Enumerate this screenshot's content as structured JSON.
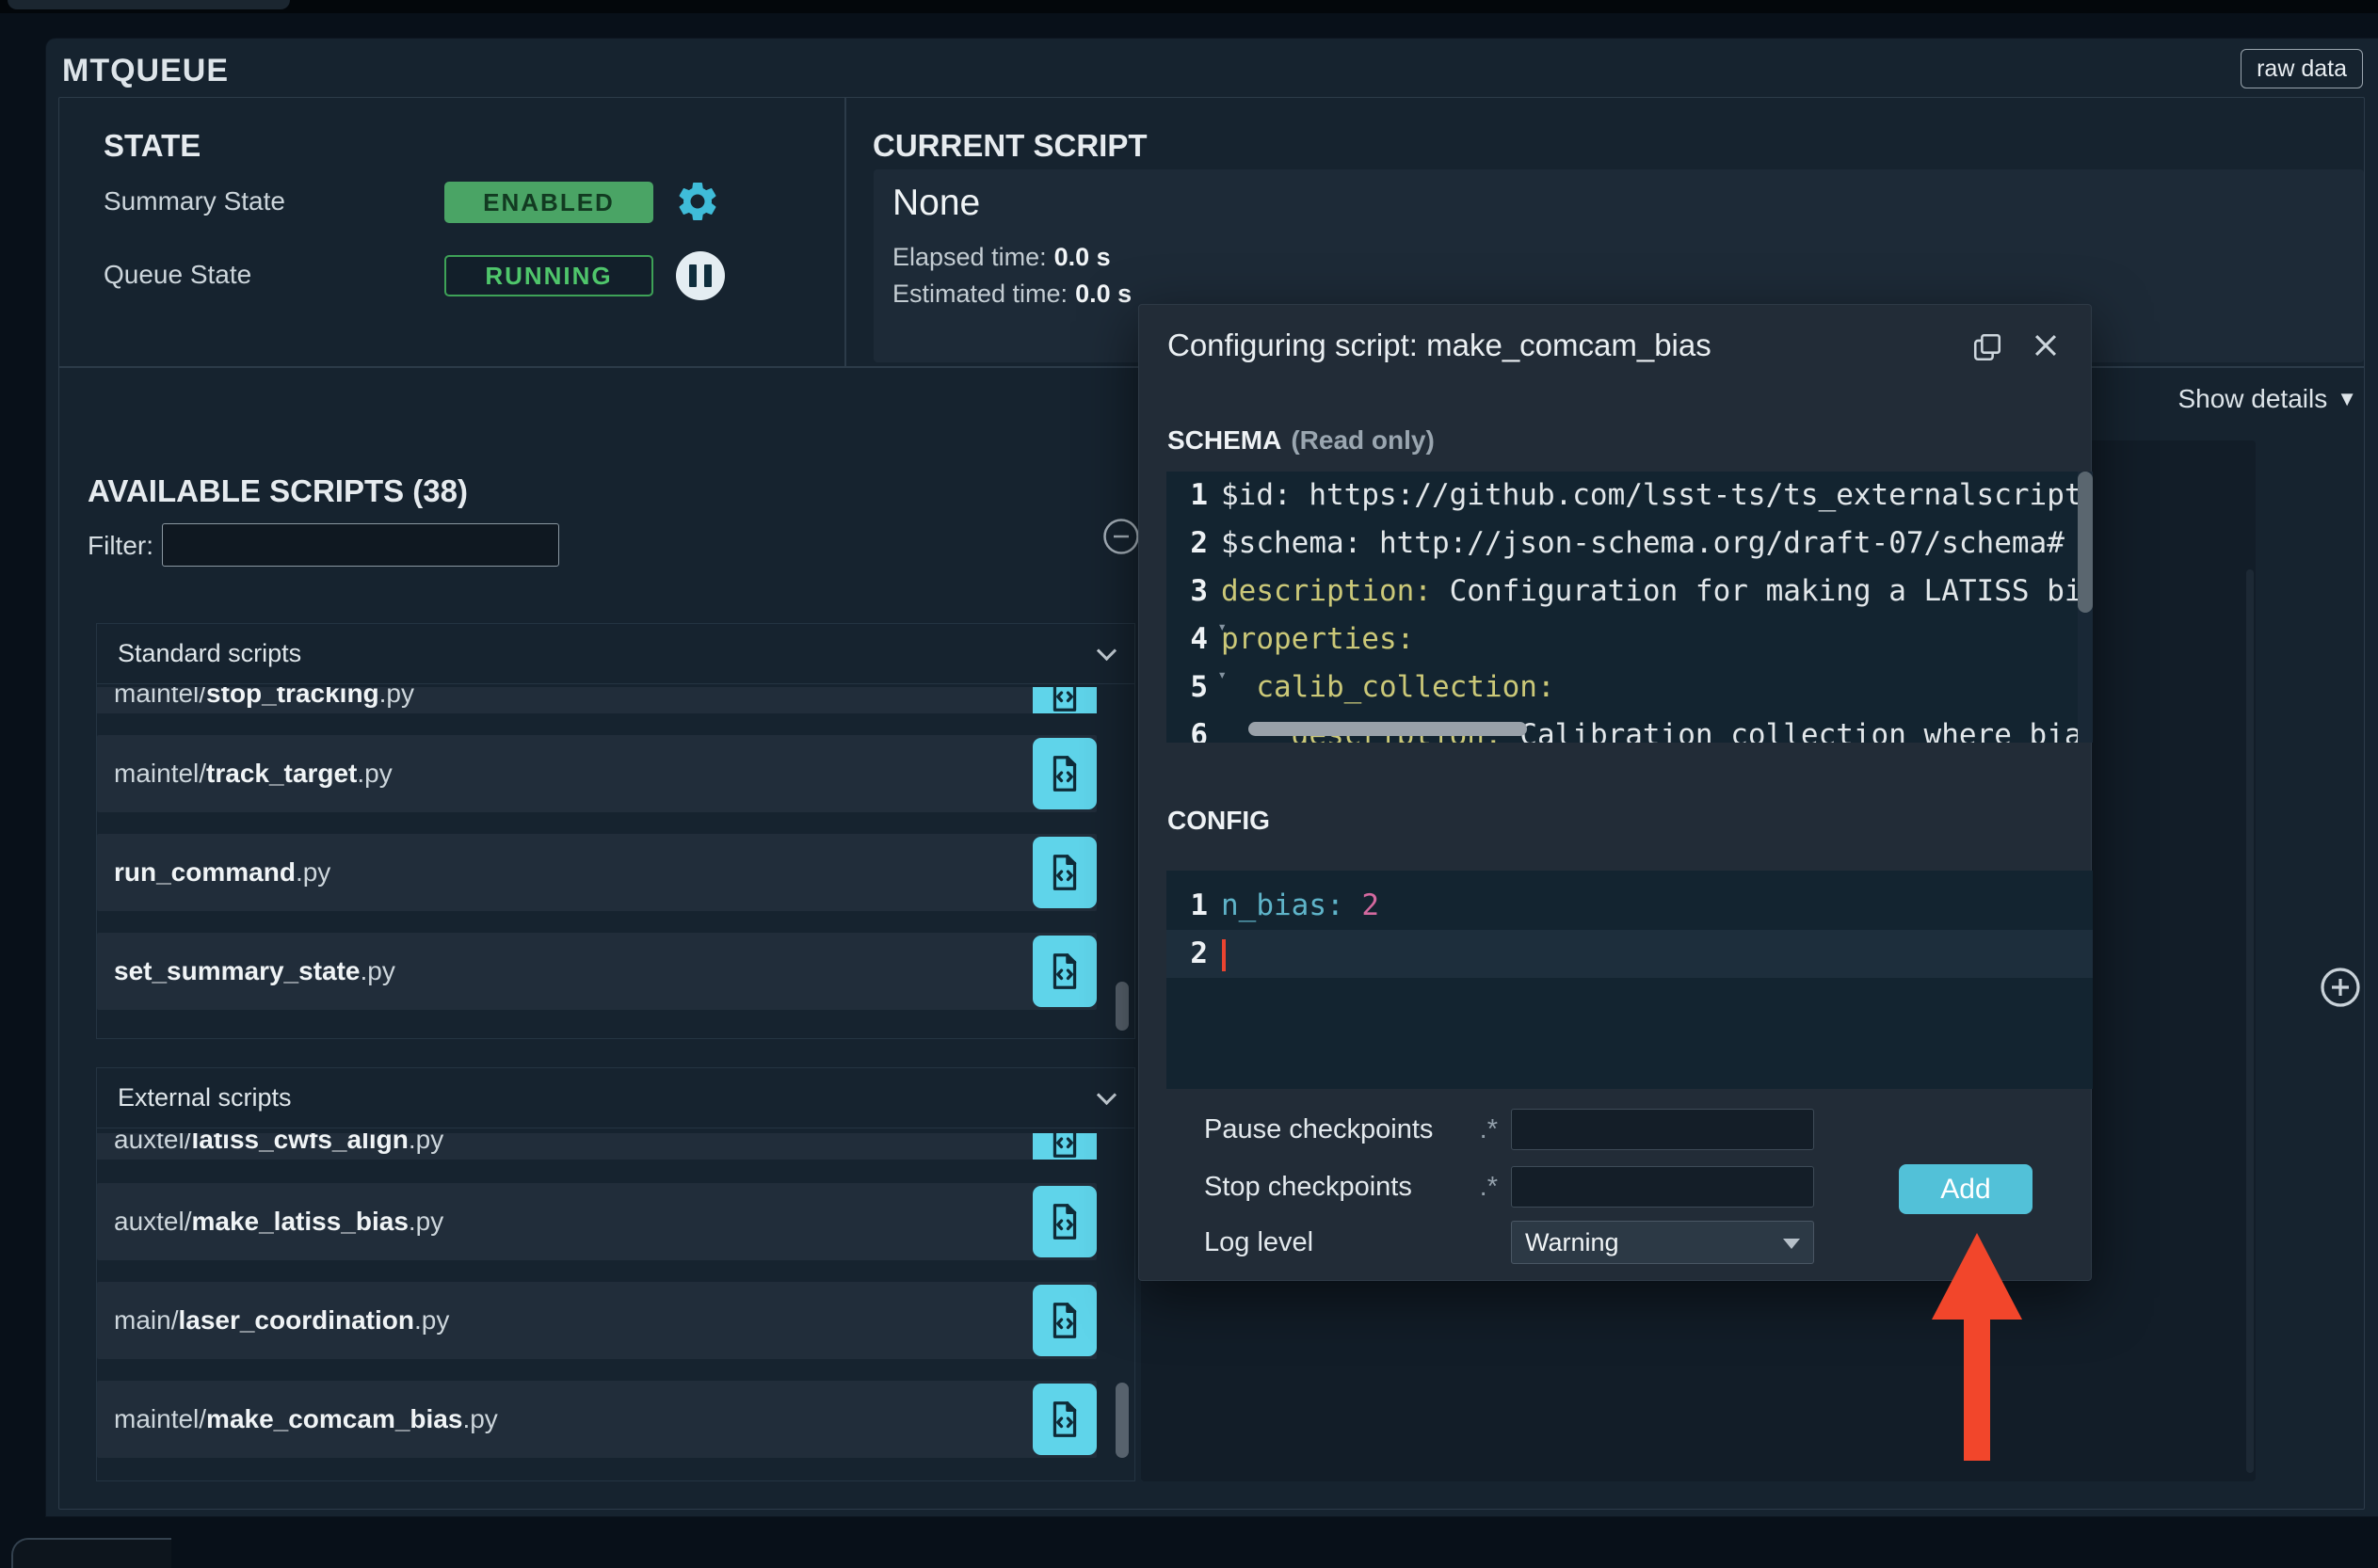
{
  "colors": {
    "accent_cyan": "#5fd4ea",
    "enabled_green": "#4aa465",
    "running_green": "#4fc66b",
    "add_button_cyan": "#52c1d8",
    "arrow_red": "#f2462b"
  },
  "icons": {
    "gear": "settings-gear",
    "pause": "pause-circle",
    "launch": "script-file",
    "collapse": "circle-minus",
    "copy": "duplicate",
    "close": "x",
    "chevron": "chevron-down",
    "plus": "plus-circle",
    "dropdown": "caret-down"
  },
  "page": {
    "title": "MTQUEUE",
    "raw_data_label": "raw data",
    "show_details_label": "Show details",
    "show_details_caret": "▼"
  },
  "state": {
    "heading": "STATE",
    "rows": [
      {
        "label": "Summary State",
        "value": "ENABLED"
      },
      {
        "label": "Queue State",
        "value": "RUNNING"
      }
    ]
  },
  "current_script": {
    "heading": "CURRENT SCRIPT",
    "name": "None",
    "elapsed": {
      "label": "Elapsed time:",
      "value": "0.0 s"
    },
    "estimated": {
      "label": "Estimated time:",
      "value": "0.0 s"
    }
  },
  "available": {
    "heading": "AVAILABLE SCRIPTS (38)",
    "filter_label": "Filter:",
    "filter_value": "",
    "sections": [
      {
        "label": "Standard scripts",
        "partial": {
          "path": "maintel/",
          "name": "stop_tracking",
          "ext": ".py"
        },
        "scripts": [
          {
            "path": "maintel/",
            "name": "track_target",
            "ext": ".py"
          },
          {
            "path": "",
            "name": "run_command",
            "ext": ".py"
          },
          {
            "path": "",
            "name": "set_summary_state",
            "ext": ".py"
          }
        ]
      },
      {
        "label": "External scripts",
        "partial": {
          "path": "auxtel/",
          "name": "latiss_cwfs_align",
          "ext": ".py"
        },
        "scripts": [
          {
            "path": "auxtel/",
            "name": "make_latiss_bias",
            "ext": ".py"
          },
          {
            "path": "main/",
            "name": "laser_coordination",
            "ext": ".py"
          },
          {
            "path": "maintel/",
            "name": "make_comcam_bias",
            "ext": ".py"
          }
        ]
      }
    ]
  },
  "modal": {
    "title": "Configuring script: make_comcam_bias",
    "schema": {
      "heading": "SCHEMA",
      "note": "(Read only)",
      "lines": [
        {
          "num": "1",
          "key": "$id:",
          "value": " https://github.com/lsst-ts/ts_externalscripts"
        },
        {
          "num": "2",
          "key": "$schema:",
          "value": " http://json-schema.org/draft-07/schema#"
        },
        {
          "num": "3",
          "key": "description:",
          "value": " Configuration for making a LATISS bias"
        },
        {
          "num": "4",
          "key": "properties:",
          "value": "",
          "fold": "▾"
        },
        {
          "num": "5",
          "key": "  calib_collection:",
          "value": "",
          "fold": "▾"
        },
        {
          "num": "6",
          "key": "    description:",
          "value": " Calibration collection where bias"
        }
      ]
    },
    "config": {
      "heading": "CONFIG",
      "lines": [
        {
          "num": "1",
          "key": "n_bias:",
          "value": " 2"
        },
        {
          "num": "2",
          "key": "",
          "value": ""
        }
      ]
    },
    "fields": {
      "pause": {
        "label": "Pause checkpoints",
        "hint": ".*",
        "value": ""
      },
      "stop": {
        "label": "Stop checkpoints",
        "hint": ".*",
        "value": ""
      },
      "log": {
        "label": "Log level",
        "value": "Warning"
      },
      "add_label": "Add"
    }
  }
}
